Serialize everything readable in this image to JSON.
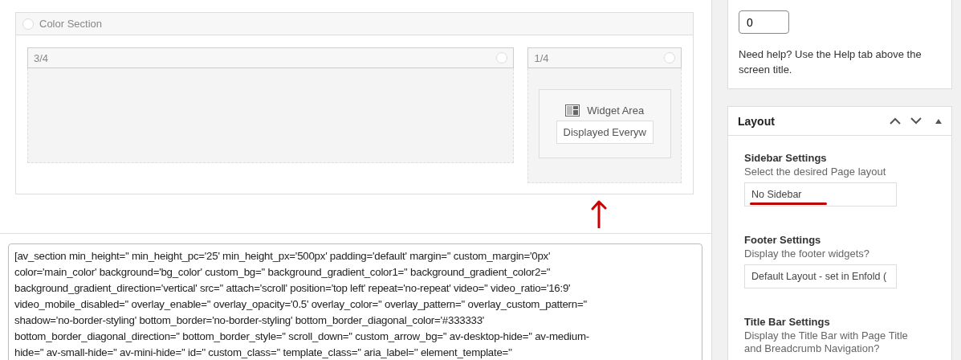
{
  "builder": {
    "section": {
      "title": "Color Section",
      "columns": [
        {
          "label": "3/4",
          "kind": "empty"
        },
        {
          "label": "1/4",
          "kind": "widget",
          "widget": {
            "title": "Widget Area",
            "value": "Displayed Everyw"
          }
        }
      ]
    }
  },
  "shortcode": {
    "text": "[av_section min_height='' min_height_pc='25' min_height_px='500px' padding='default' margin='' custom_margin='0px'\ncolor='main_color' background='bg_color' custom_bg='' background_gradient_color1='' background_gradient_color2=''\nbackground_gradient_direction='vertical' src='' attach='scroll' position='top left' repeat='no-repeat' video='' video_ratio='16:9'\nvideo_mobile_disabled='' overlay_enable='' overlay_opacity='0.5' overlay_color='' overlay_pattern='' overlay_custom_pattern=''\nshadow='no-border-styling' bottom_border='no-border-styling' bottom_border_diagonal_color='#333333'\nbottom_border_diagonal_direction='' bottom_border_style='' scroll_down='' custom_arrow_bg='' av-desktop-hide='' av-medium-\nhide='' av-small-hide='' av-mini-hide='' id='' custom_class='' template_class='' aria_label='' element_template=''"
  },
  "sidebar": {
    "order": {
      "value": "0",
      "help": "Need help? Use the Help tab above the screen title."
    },
    "layout": {
      "title": "Layout",
      "settings": [
        {
          "title": "Sidebar Settings",
          "description": "Select the desired Page layout",
          "kind": "select",
          "value": "No Sidebar",
          "underlined": true
        },
        {
          "title": "Footer Settings",
          "description": "Display the footer widgets?",
          "kind": "select",
          "value": "Default Layout - set in Enfold (",
          "underlined": false
        },
        {
          "title": "Title Bar Settings",
          "description": "Display the Title Bar with Page Title and Breadcrumb Navigation?",
          "kind": "none"
        }
      ]
    }
  }
}
